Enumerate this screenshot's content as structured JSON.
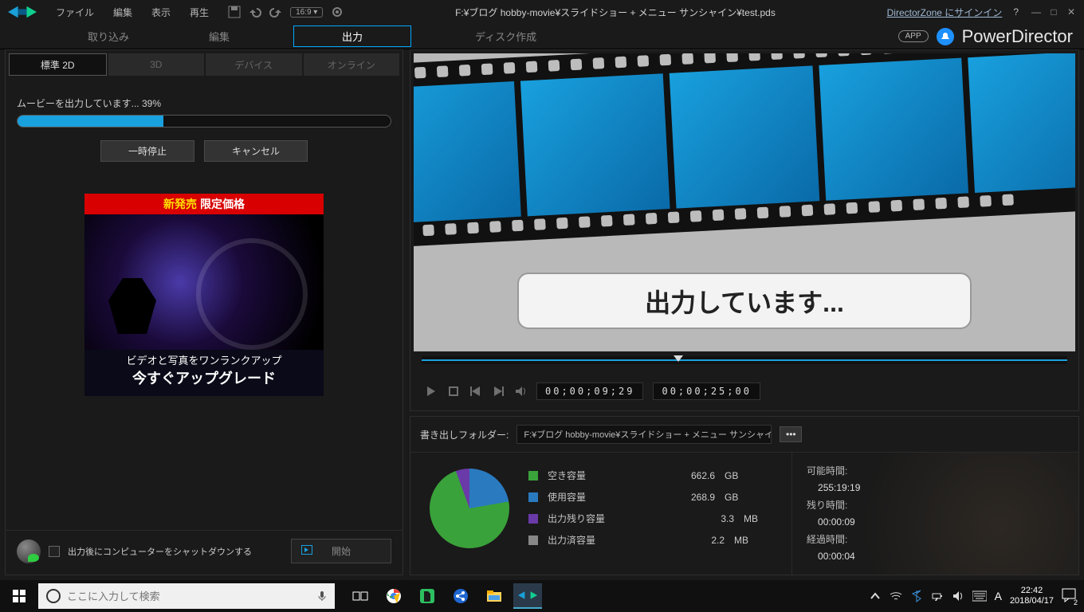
{
  "menu": {
    "file": "ファイル",
    "edit": "編集",
    "view": "表示",
    "play": "再生"
  },
  "titlePath": "F:¥ブログ hobby-movie¥スライドショー + メニュー サンシャイン¥test.pds",
  "dzLink": "DirectorZone にサインイン",
  "brand": {
    "app": "APP",
    "product": "PowerDirector"
  },
  "mainTabs": {
    "capture": "取り込み",
    "edit": "編集",
    "produce": "出力",
    "disc": "ディスク作成"
  },
  "subTabs": {
    "std": "標準 2D",
    "threeD": "3D",
    "device": "デバイス",
    "online": "オンライン"
  },
  "progress": {
    "label": "ムービーを出力しています... 39%",
    "percent": 39
  },
  "buttons": {
    "pause": "一時停止",
    "cancel": "キャンセル",
    "start": "開始"
  },
  "ad": {
    "badgeYellow": "新発売",
    "badgeWhite": "限定価格",
    "line1": "ビデオと写真をワンランクアップ",
    "line2": "今すぐアップグレード"
  },
  "shutdown": {
    "label": "出力後にコンピューターをシャットダウンする"
  },
  "preview": {
    "banner": "出力しています...",
    "tc1": "00;00;09;29",
    "tc2": "00;00;25;00"
  },
  "output": {
    "folderLabel": "書き出しフォルダー:",
    "path": "F:¥ブログ hobby-movie¥スライドショー + メニュー サンシャイン¥Produ"
  },
  "legend": {
    "free": {
      "label": "空き容量",
      "val": "662.6",
      "unit": "GB",
      "color": "#3aa23a"
    },
    "used": {
      "label": "使用容量",
      "val": "268.9",
      "unit": "GB",
      "color": "#2a7ac0"
    },
    "remain": {
      "label": "出力残り容量",
      "val": "3.3",
      "unit": "MB",
      "color": "#6a3aa8"
    },
    "done": {
      "label": "出力済容量",
      "val": "2.2",
      "unit": "MB",
      "color": "#888"
    }
  },
  "times": {
    "possibleL": "可能時間:",
    "possibleV": "255:19:19",
    "remainL": "残り時間:",
    "remainV": "00:00:09",
    "elapsedL": "経過時間:",
    "elapsedV": "00:00:04"
  },
  "taskbar": {
    "searchPlaceholder": "ここに入力して検索",
    "ime": "A",
    "time": "22:42",
    "date": "2018/04/17",
    "notif": "2"
  }
}
